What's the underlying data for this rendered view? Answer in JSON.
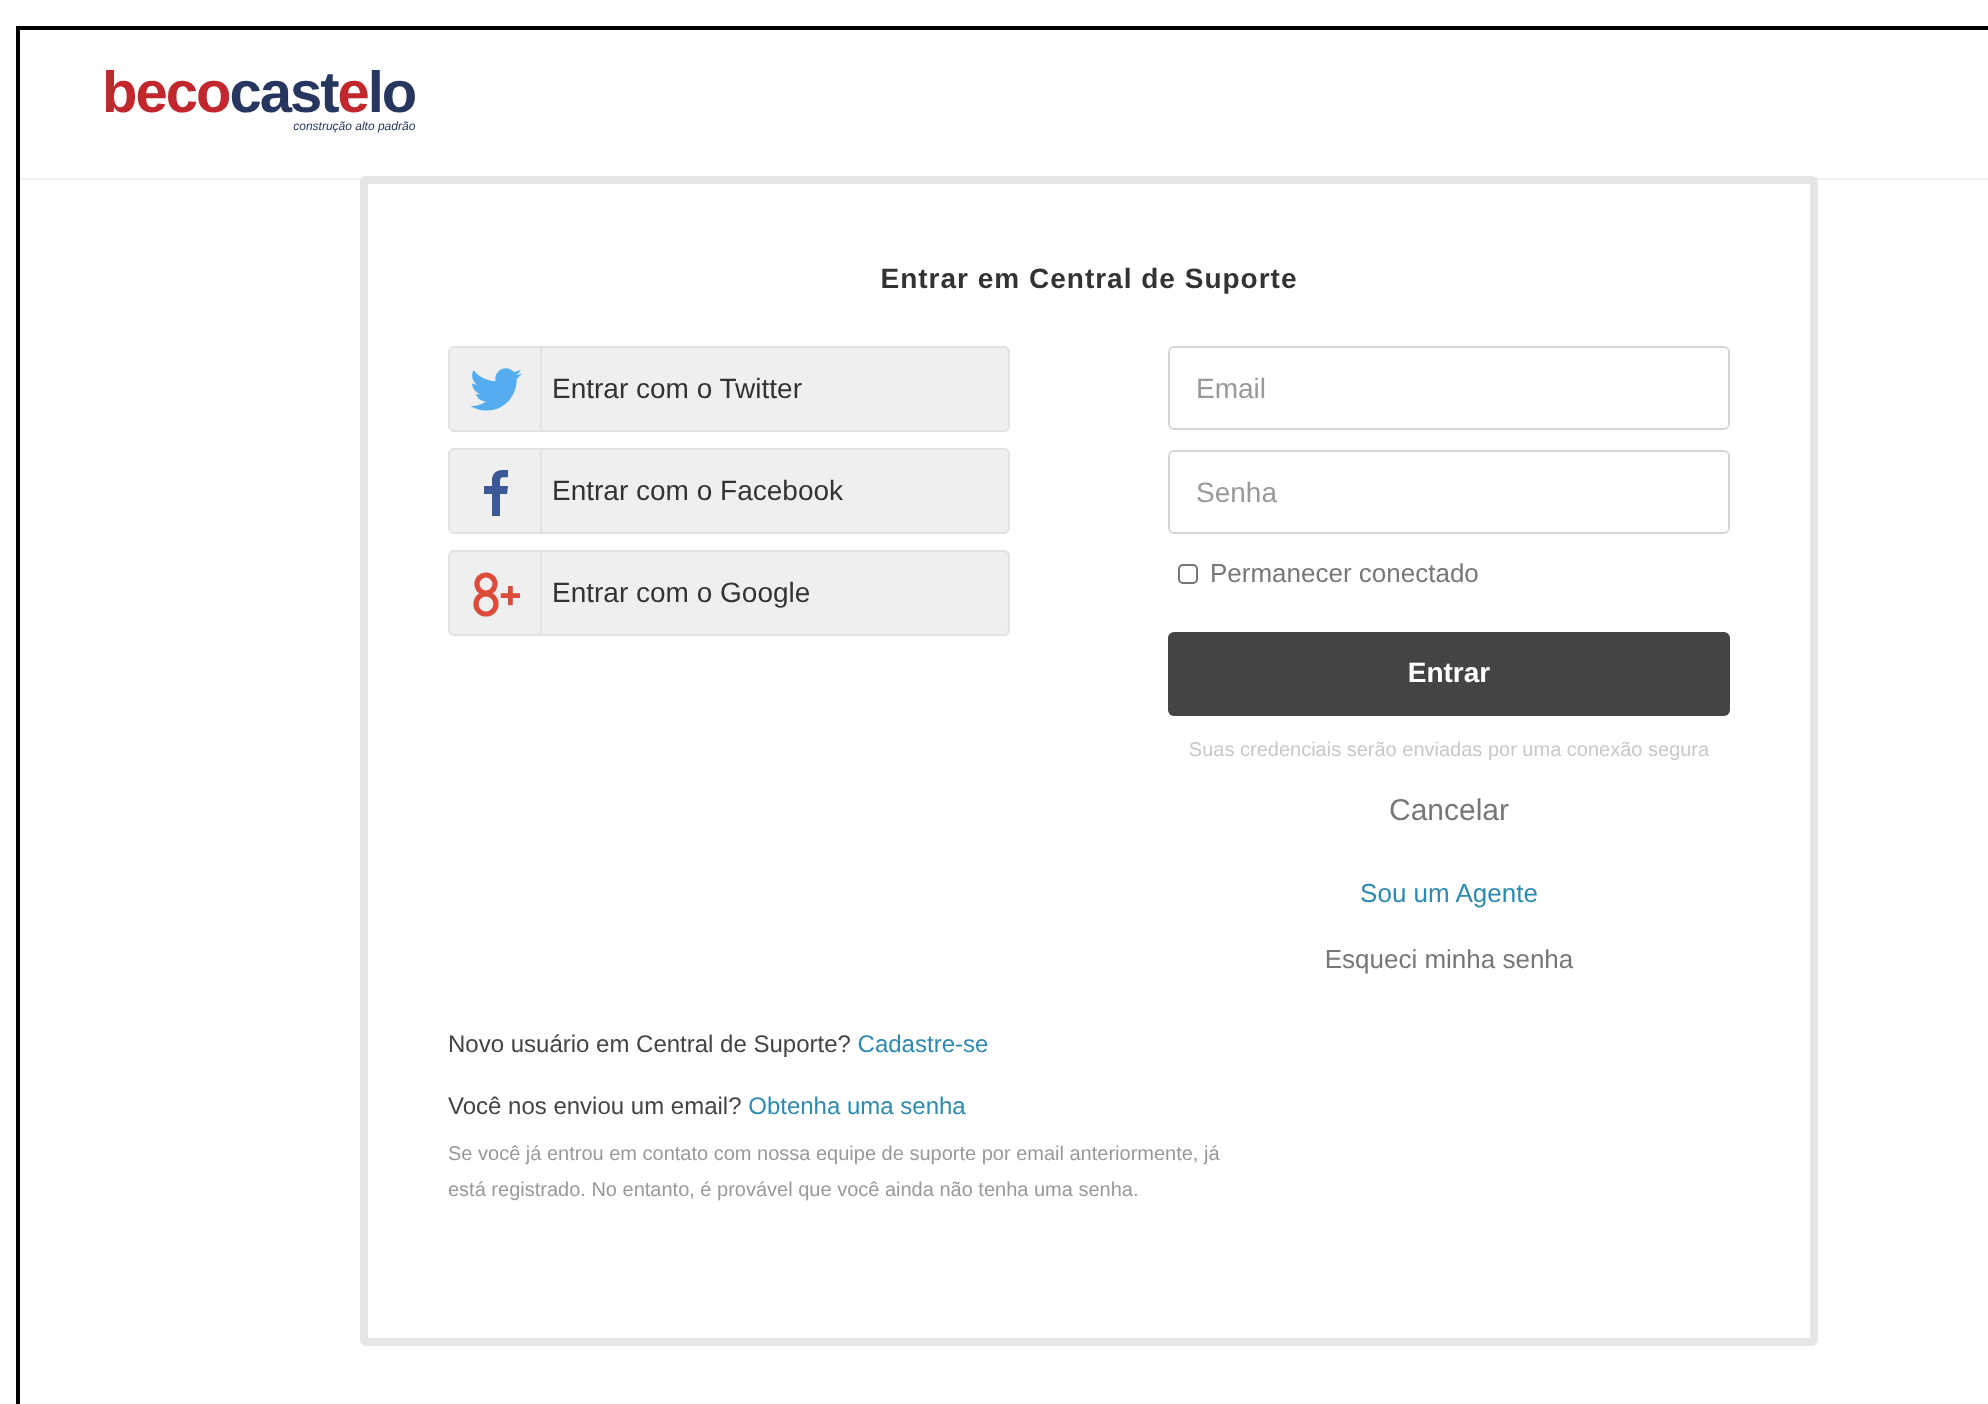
{
  "logo": {
    "parts": [
      {
        "text": "beco",
        "color": "#c1272d"
      },
      {
        "text": "cast",
        "color": "#27365f"
      },
      {
        "text": "e",
        "color": "#c1272d"
      },
      {
        "text": "lo",
        "color": "#27365f"
      }
    ],
    "tagline": "construção alto padrão"
  },
  "title": "Entrar em Central de Suporte",
  "social_buttons": [
    {
      "kind": "twitter",
      "label": "Entrar com o Twitter"
    },
    {
      "kind": "facebook",
      "label": "Entrar com o Facebook"
    },
    {
      "kind": "google",
      "label": "Entrar com o Google"
    }
  ],
  "email_field": {
    "placeholder": "Email"
  },
  "password_field": {
    "placeholder": "Senha"
  },
  "remember": {
    "label": "Permanecer conectado",
    "checked": false
  },
  "submit_button": "Entrar",
  "secure_note": "Suas credenciais serão enviadas por uma conexão segura",
  "cancel_link": "Cancelar",
  "agent_link": "Sou um Agente",
  "forgot_link": "Esqueci minha senha",
  "new_user": {
    "text": "Novo usuário em Central de Suporte?",
    "link": "Cadastre-se"
  },
  "emailed": {
    "text": "Você nos enviou um email?",
    "link": "Obtenha uma senha"
  },
  "help_text": "Se você já entrou em contato com nossa equipe de suporte por email anteriormente, já está registrado. No entanto, é provável que você ainda não tenha uma senha."
}
